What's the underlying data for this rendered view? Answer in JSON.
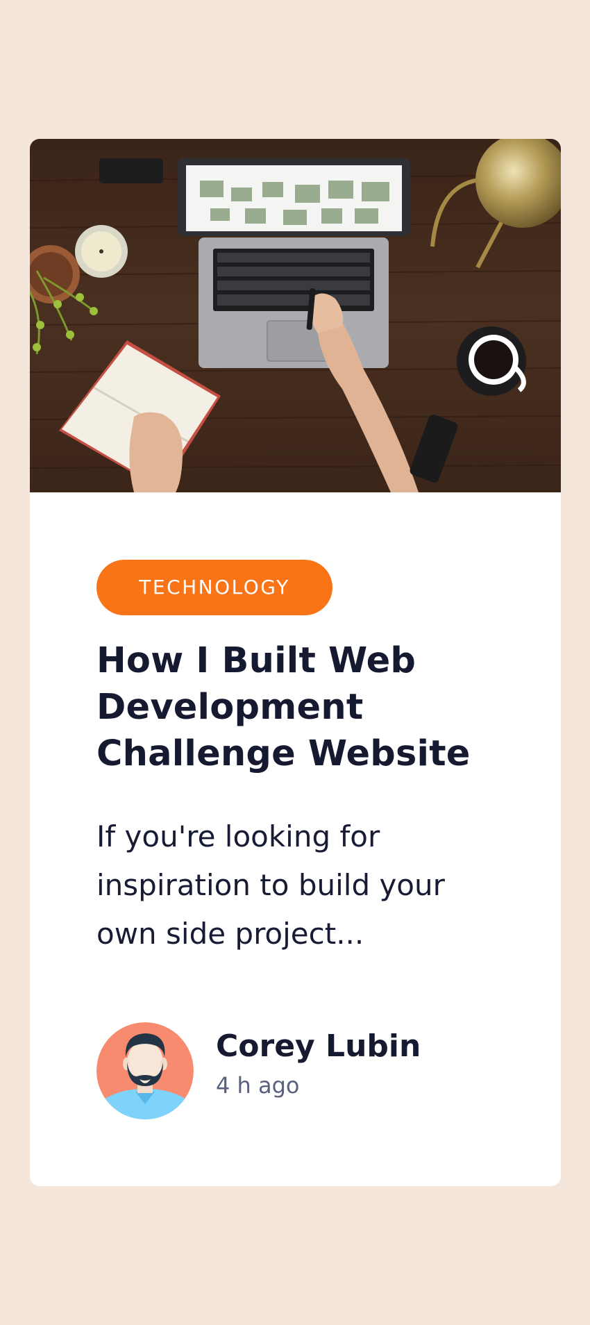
{
  "card": {
    "image_alt": "Person typing on a laptop on a wooden desk with a notebook, candle, plant and coffee cup",
    "category": "TECHNOLOGY",
    "title": "How I Built Web Development Challenge Website",
    "excerpt": "If you're looking for inspiration to build your own side project...",
    "author": {
      "name": "Corey Lubin",
      "time": "4 h ago",
      "avatar_icon": "bearded-man-avatar"
    }
  },
  "colors": {
    "page_background": "#f5e6db",
    "card_background": "#ffffff",
    "accent": "#f97416",
    "heading": "#161a30",
    "muted": "#5a617d"
  }
}
